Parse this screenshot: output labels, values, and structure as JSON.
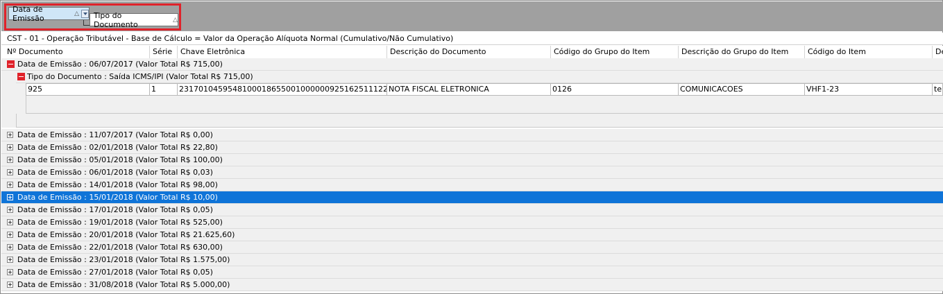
{
  "group_panel": {
    "chips": [
      {
        "label": "Data de Emissão"
      },
      {
        "label": "Tipo do Documento"
      }
    ]
  },
  "grid_caption": "CST - 01 - Operação Tributável - Base de Cálculo = Valor da Operação Alíquota Normal (Cumulativo/Não Cumulativo)",
  "columns": [
    "Nº Documento",
    "Série",
    "Chave Eletrônica",
    "Descrição do Documento",
    "Código do Grupo do Item",
    "Descrição do Grupo do Item",
    "Código do Item",
    "De"
  ],
  "expanded_group": {
    "label": "Data de Emissão : 06/07/2017 (Valor Total R$ 715,00)",
    "subgroup_label": "Tipo do Documento : Saída ICMS/IPI (Valor Total R$ 715,00)",
    "row": [
      "925",
      "1",
      "23170104595481000186550010000009251625111222",
      "NOTA FISCAL ELETRONICA",
      "0126",
      "COMUNICACOES",
      "VHF1-23",
      "tele"
    ]
  },
  "collapsed_groups": [
    {
      "label": "Data de Emissão : 11/07/2017 (Valor Total R$ 0,00)",
      "selected": false
    },
    {
      "label": "Data de Emissão : 02/01/2018 (Valor Total R$ 22,80)",
      "selected": false
    },
    {
      "label": "Data de Emissão : 05/01/2018 (Valor Total R$ 100,00)",
      "selected": false
    },
    {
      "label": "Data de Emissão : 06/01/2018 (Valor Total R$ 0,03)",
      "selected": false
    },
    {
      "label": "Data de Emissão : 14/01/2018 (Valor Total R$ 98,00)",
      "selected": false
    },
    {
      "label": "Data de Emissão : 15/01/2018 (Valor Total R$ 10,00)",
      "selected": true
    },
    {
      "label": "Data de Emissão : 17/01/2018 (Valor Total R$ 0,05)",
      "selected": false
    },
    {
      "label": "Data de Emissão : 19/01/2018 (Valor Total R$ 525,00)",
      "selected": false
    },
    {
      "label": "Data de Emissão : 20/01/2018 (Valor Total R$ 21.625,60)",
      "selected": false
    },
    {
      "label": "Data de Emissão : 22/01/2018 (Valor Total R$ 630,00)",
      "selected": false
    },
    {
      "label": "Data de Emissão : 23/01/2018 (Valor Total R$ 1.575,00)",
      "selected": false
    },
    {
      "label": "Data de Emissão : 27/01/2018 (Valor Total R$ 0,05)",
      "selected": false
    },
    {
      "label": "Data de Emissão : 31/08/2018 (Valor Total R$ 5.000,00)",
      "selected": false
    }
  ],
  "colors": {
    "selected_row": "#0f74d8",
    "highlight_border": "#e0222a",
    "group_bar": "#a0a0a0"
  }
}
